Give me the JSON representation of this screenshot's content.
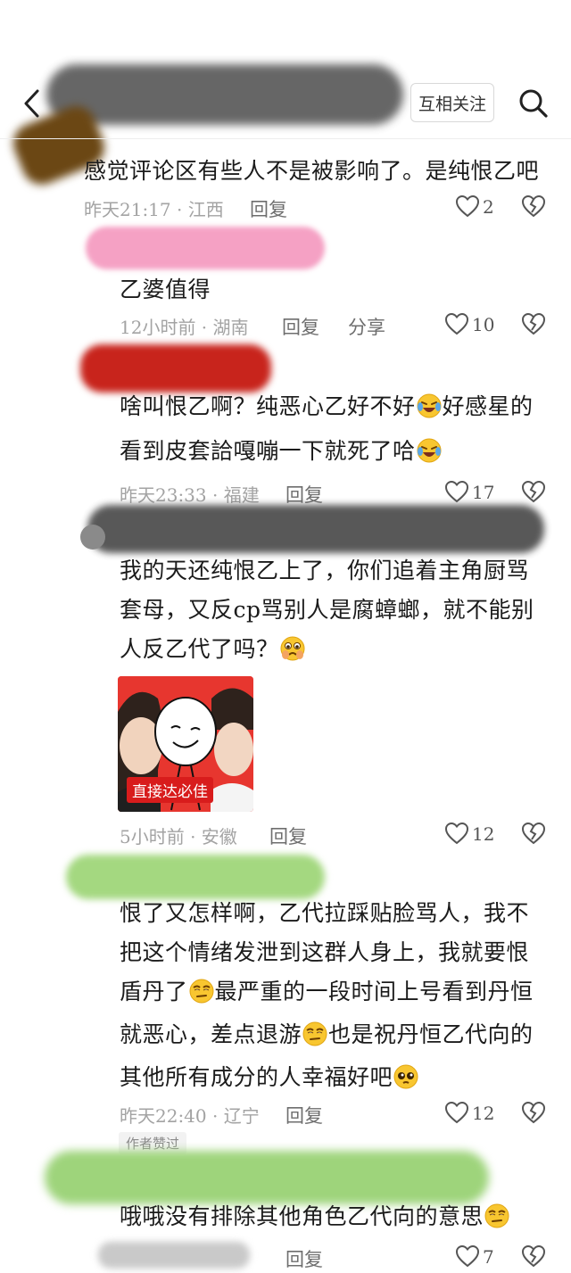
{
  "header": {
    "follow_label": "互相关注"
  },
  "comments": [
    {
      "text": "感觉评论区有些人不是被影响了。是纯恨乙吧",
      "meta": "昨天21:17 · 江西",
      "reply": "回复",
      "likes": "2"
    },
    {
      "text": "乙婆值得",
      "meta": "12小时前 · 湖南",
      "reply": "回复",
      "share": "分享",
      "likes": "10"
    },
    {
      "lines": [
        "啥叫恨乙啊？纯恶心乙好不好",
        "好感星的",
        "看到皮套詥嘎嘣一下就死了哈"
      ],
      "meta": "昨天23:33 · 福建",
      "reply": "回复",
      "likes": "17"
    },
    {
      "lines": [
        "我的天还纯恨乙上了，你们追着主角厨骂",
        "套母，又反cp骂别人是腐蟑螂，就不能别",
        "人反乙代了吗？"
      ],
      "sticker_caption": "直接达必佳",
      "meta": "5小时前 · 安徽",
      "reply": "回复",
      "likes": "12"
    },
    {
      "lines": [
        "恨了又怎样啊，乙代拉踩贴脸骂人，我不",
        "把这个情绪发泄到这群人身上，我就要恨",
        "盾丹了",
        "最严重的一段时间上号看到丹恒",
        "就恶心，差点退游",
        "也是祝丹恒乙代向的",
        "其他所有成分的人幸福好吧"
      ],
      "meta": "昨天22:40 · 辽宁",
      "reply": "回复",
      "likes": "12",
      "badge": "作者赞过"
    },
    {
      "text": "哦哦没有排除其他角色乙代向的意思",
      "reply": "回复",
      "likes": "7"
    }
  ],
  "colors": {
    "text": "#1b1b1b",
    "meta": "#a3a3a3",
    "pink_blur": "#f5a1c4",
    "red_blur": "#c8241c",
    "green_blur": "#a4d880"
  },
  "icons": [
    "back-arrow-icon",
    "search-icon",
    "heart-icon",
    "broken-heart-icon",
    "laughing-crying-emoji",
    "crying-emoji",
    "rolling-eyes-emoji",
    "pleading-emoji"
  ]
}
